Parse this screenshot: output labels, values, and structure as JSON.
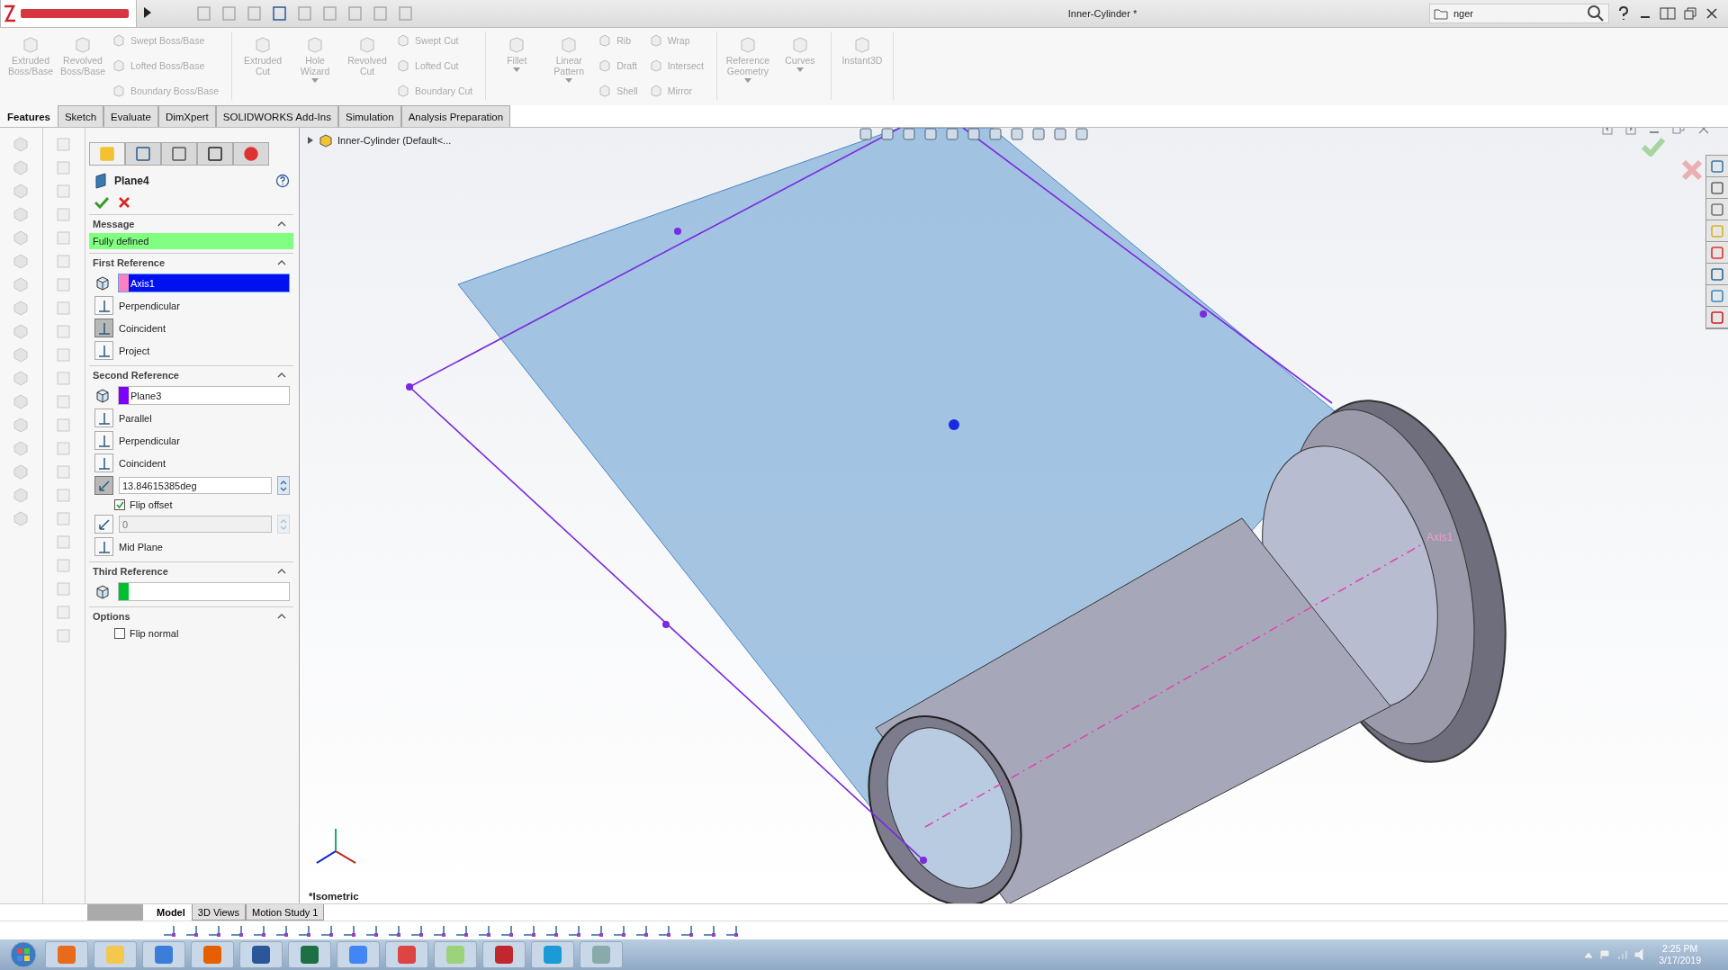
{
  "window": {
    "title": "Inner-Cylinder *",
    "search": {
      "value": "nger"
    }
  },
  "ribbon": {
    "groups": [
      {
        "items": [
          {
            "label": "Extruded Boss/Base",
            "kind": "large"
          },
          {
            "label": "Revolved Boss/Base",
            "kind": "large"
          },
          {
            "label": "Swept Boss/Base",
            "kind": "small"
          },
          {
            "label": "Lofted Boss/Base",
            "kind": "small"
          },
          {
            "label": "Boundary Boss/Base",
            "kind": "small"
          }
        ]
      },
      {
        "items": [
          {
            "label": "Extruded Cut",
            "kind": "large"
          },
          {
            "label": "Hole Wizard",
            "kind": "large",
            "dropdown": true
          },
          {
            "label": "Revolved Cut",
            "kind": "large"
          },
          {
            "label": "Swept Cut",
            "kind": "small"
          },
          {
            "label": "Lofted Cut",
            "kind": "small"
          },
          {
            "label": "Boundary Cut",
            "kind": "small"
          }
        ]
      },
      {
        "items": [
          {
            "label": "Fillet",
            "kind": "large",
            "dropdown": true
          },
          {
            "label": "Linear Pattern",
            "kind": "large",
            "dropdown": true
          },
          {
            "label": "Rib",
            "kind": "small"
          },
          {
            "label": "Draft",
            "kind": "small"
          },
          {
            "label": "Shell",
            "kind": "small"
          },
          {
            "label": "Wrap",
            "kind": "small"
          },
          {
            "label": "Intersect",
            "kind": "small"
          },
          {
            "label": "Mirror",
            "kind": "small"
          }
        ]
      },
      {
        "items": [
          {
            "label": "Reference Geometry",
            "kind": "large",
            "dropdown": true
          },
          {
            "label": "Curves",
            "kind": "large",
            "dropdown": true
          }
        ]
      },
      {
        "items": [
          {
            "label": "Instant3D",
            "kind": "large"
          }
        ]
      }
    ]
  },
  "command_tabs": [
    {
      "label": "Features",
      "selected": true
    },
    {
      "label": "Sketch",
      "selected": false
    },
    {
      "label": "Evaluate",
      "selected": false
    },
    {
      "label": "DimXpert",
      "selected": false
    },
    {
      "label": "SOLIDWORKS Add-Ins",
      "selected": false
    },
    {
      "label": "Simulation",
      "selected": false
    },
    {
      "label": "Analysis Preparation",
      "selected": false
    }
  ],
  "property_manager": {
    "tabs": [
      {
        "selected": true
      },
      {
        "selected": false
      },
      {
        "selected": false
      },
      {
        "selected": false
      },
      {
        "selected": false
      }
    ],
    "title": "Plane4",
    "sections": [
      {
        "kind": "message",
        "title": "Message",
        "text": "Fully defined"
      },
      {
        "kind": "reference",
        "title": "First Reference",
        "selection": {
          "value": "Axis1",
          "color": "#ff80c0",
          "selected": true
        },
        "options": [
          {
            "kind": "toggle",
            "label": "Perpendicular",
            "on": false
          },
          {
            "kind": "toggle",
            "label": "Coincident",
            "on": true
          },
          {
            "kind": "toggle",
            "label": "Project",
            "on": false
          }
        ]
      },
      {
        "kind": "reference",
        "title": "Second Reference",
        "selection": {
          "value": "Plane3",
          "color": "#8000ff",
          "selected": false
        },
        "options": [
          {
            "kind": "toggle",
            "label": "Parallel",
            "on": false
          },
          {
            "kind": "toggle",
            "label": "Perpendicular",
            "on": false
          },
          {
            "kind": "toggle",
            "label": "Coincident",
            "on": false
          },
          {
            "kind": "value",
            "value": "13.84615385deg",
            "on": true,
            "disabled": false
          },
          {
            "kind": "checkbox",
            "label": "Flip offset",
            "checked": true
          },
          {
            "kind": "value",
            "value": "0",
            "on": false,
            "disabled": true
          },
          {
            "kind": "toggle",
            "label": "Mid Plane",
            "on": false
          }
        ]
      },
      {
        "kind": "reference",
        "title": "Third Reference",
        "selection": {
          "color": "#00c030",
          "selected": false
        }
      },
      {
        "kind": "options",
        "title": "Options",
        "options": [
          {
            "kind": "checkbox",
            "label": "Flip normal",
            "checked": false
          }
        ]
      }
    ]
  },
  "viewport": {
    "tree_item": "Inner-Cylinder  (Default<...",
    "axis_label": "Axis1",
    "view_name": "*Isometric"
  },
  "model_tabs": [
    {
      "label": "Model",
      "selected": true
    },
    {
      "label": "3D Views",
      "selected": false
    },
    {
      "label": "Motion Study 1",
      "selected": false
    }
  ],
  "taskbar": {
    "time": "2:25 PM",
    "date": "3/17/2019"
  }
}
